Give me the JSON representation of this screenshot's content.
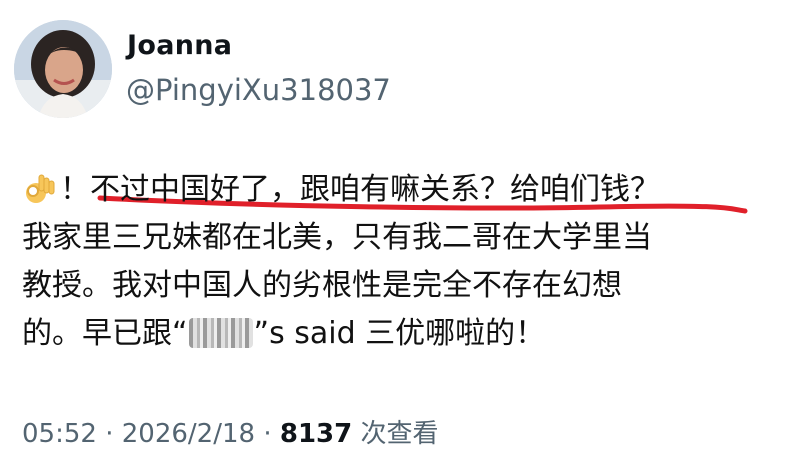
{
  "author": {
    "name": "Joanna",
    "handle": "@PingyiXu318037"
  },
  "tweet": {
    "emoji": "ok-hand",
    "lines": [
      "！不过中国好了，跟咱有嘛关系？给咱们钱？",
      "我家里三兄妹都在北美，只有我二哥在大学里当",
      "教授。我对中国人的劣根性是完全不存在幻想"
    ],
    "line4_before": "的。早已跟“",
    "line4_after": "”s said 三优哪啦的！"
  },
  "meta": {
    "time": "05:52",
    "sep1": " · ",
    "date": "2026/2/18",
    "sep2": " · ",
    "views": "8137",
    "views_label": " 次查看"
  },
  "colors": {
    "underline": "#e0202a",
    "handle": "#536471"
  }
}
